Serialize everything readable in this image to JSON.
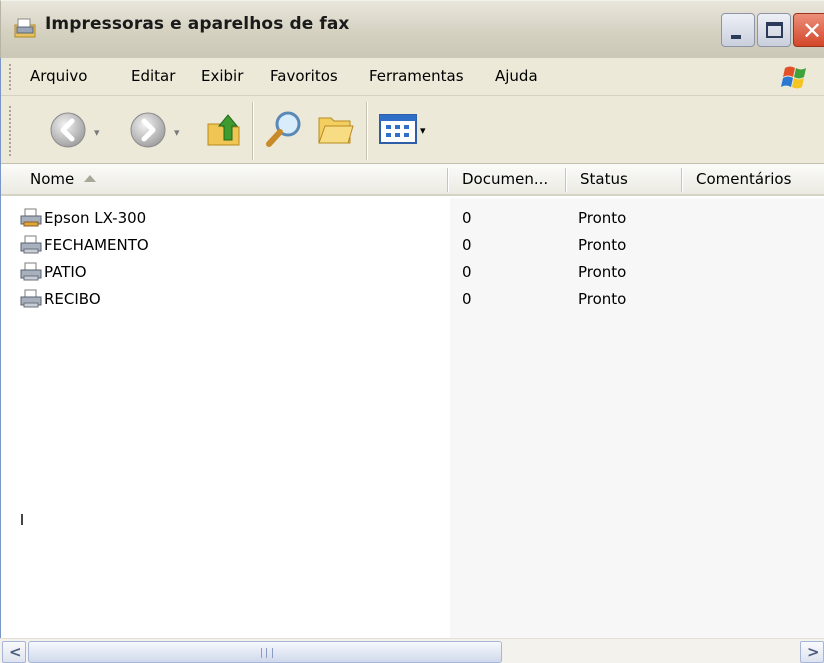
{
  "window": {
    "title": "Impressoras e aparelhos de fax",
    "icon": "printer-folder-icon"
  },
  "menu": [
    "Arquivo",
    "Editar",
    "Exibir",
    "Favoritos",
    "Ferramentas",
    "Ajuda"
  ],
  "toolbar": {
    "buttons": [
      "back-icon",
      "forward-icon",
      "up-folder-icon",
      "search-icon",
      "folders-icon",
      "views-icon"
    ]
  },
  "columns": {
    "name": "Nome",
    "documents": "Documen...",
    "status": "Status",
    "comments": "Comentários",
    "sorted_by": "Nome",
    "sort_direction": "ascending"
  },
  "printers": [
    {
      "name": "Epson LX-300",
      "documents": "0",
      "status": "Pronto",
      "comments": "",
      "icon": "printer-icon"
    },
    {
      "name": "FECHAMENTO",
      "documents": "0",
      "status": "Pronto",
      "comments": "",
      "icon": "printer-icon"
    },
    {
      "name": "PATIO",
      "documents": "0",
      "status": "Pronto",
      "comments": "",
      "icon": "printer-icon"
    },
    {
      "name": "RECIBO",
      "documents": "0",
      "status": "Pronto",
      "comments": "",
      "icon": "printer-icon"
    }
  ],
  "colors": {
    "title_bar": "#d6d2c2",
    "menu_bar": "#ece9d8",
    "close_button": "#d3462a",
    "window_controls": "#c9cfdc"
  }
}
